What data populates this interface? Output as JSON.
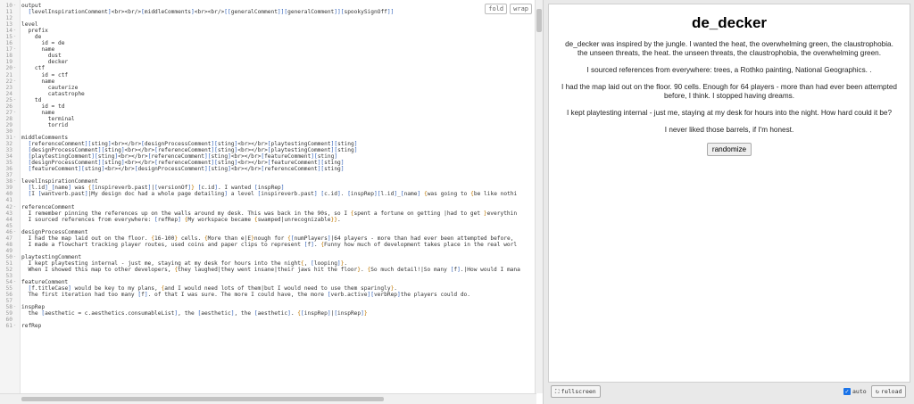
{
  "editor": {
    "fold_label": "fold",
    "wrap_label": "wrap",
    "lines": [
      {
        "n": "10",
        "f": "-",
        "t": "output"
      },
      {
        "n": "11",
        "f": "",
        "t": "  [levelInspirationComment]<br><br/>[middleComments]<br><br/>[[generalComment]][generalComment]][spookySignOff]]"
      },
      {
        "n": "12",
        "f": "",
        "t": ""
      },
      {
        "n": "13",
        "f": "",
        "t": "level"
      },
      {
        "n": "14",
        "f": "-",
        "t": "  prefix"
      },
      {
        "n": "15",
        "f": "-",
        "t": "    de"
      },
      {
        "n": "16",
        "f": "",
        "t": "      id = de"
      },
      {
        "n": "17",
        "f": "-",
        "t": "      name"
      },
      {
        "n": "18",
        "f": "",
        "t": "        dust"
      },
      {
        "n": "19",
        "f": "",
        "t": "        decker"
      },
      {
        "n": "20",
        "f": "-",
        "t": "    ctf"
      },
      {
        "n": "21",
        "f": "",
        "t": "      id = ctf"
      },
      {
        "n": "22",
        "f": "-",
        "t": "      name"
      },
      {
        "n": "23",
        "f": "",
        "t": "        cauterize"
      },
      {
        "n": "24",
        "f": "",
        "t": "        catastrophe"
      },
      {
        "n": "25",
        "f": "-",
        "t": "    td"
      },
      {
        "n": "26",
        "f": "",
        "t": "      id = td"
      },
      {
        "n": "27",
        "f": "-",
        "t": "      name"
      },
      {
        "n": "28",
        "f": "",
        "t": "        terminal"
      },
      {
        "n": "29",
        "f": "",
        "t": "        torrid"
      },
      {
        "n": "30",
        "f": "",
        "t": ""
      },
      {
        "n": "31",
        "f": "-",
        "t": "middleComments"
      },
      {
        "n": "32",
        "f": "",
        "t": "  [referenceComment][sting]<br></br>[designProcessComment][sting]<br></br>[playtestingComment][sting]"
      },
      {
        "n": "33",
        "f": "",
        "t": "  [designProcessComment][sting]<br></br>[referenceComment][sting]<br></br>[playtestingComment][sting]"
      },
      {
        "n": "34",
        "f": "",
        "t": "  [playtestingComment][sting]<br></br>[referenceComment][sting]<br></br>[featureComment][sting]"
      },
      {
        "n": "35",
        "f": "",
        "t": "  [designProcessComment][sting]<br></br>[referenceComment][sting]<br></br>[featureComment][sting]"
      },
      {
        "n": "36",
        "f": "",
        "t": "  [featureComment][sting]<br></br>[designProcessComment][sting]<br></br>[referenceComment][sting]"
      },
      {
        "n": "37",
        "f": "",
        "t": ""
      },
      {
        "n": "38",
        "f": "-",
        "t": "levelInspirationComment"
      },
      {
        "n": "39",
        "f": "",
        "t": "  [l.id]_[name] was {[inspireverb.past]|[versionOf]} [c.id]. I wanted [inspRep]"
      },
      {
        "n": "40",
        "f": "",
        "t": "  [I [wantverb.past]|My design doc had a whole page detailing] a level [inspireverb.past] [c.id]. [inspRep][l.id]_[name] {was going to {be like nothi"
      },
      {
        "n": "41",
        "f": "",
        "t": ""
      },
      {
        "n": "42",
        "f": "-",
        "t": "referenceComment"
      },
      {
        "n": "43",
        "f": "",
        "t": "  I remember pinning the references up on the walls around my desk. This was back in the 90s, so I {spent a fortune on getting |had to get }everythin"
      },
      {
        "n": "44",
        "f": "",
        "t": "  I sourced references from everywhere: [refRep] {My workspace became {swamped|unrecognizable}}."
      },
      {
        "n": "45",
        "f": "",
        "t": ""
      },
      {
        "n": "46",
        "f": "-",
        "t": "designProcessComment"
      },
      {
        "n": "47",
        "f": "",
        "t": "  I had the map laid out on the floor. {16-100} cells. {More than e|E}nough for {[numPlayers]|64 players - more than had ever been attempted before, "
      },
      {
        "n": "48",
        "f": "",
        "t": "  I made a flowchart tracking player routes, used coins and paper clips to represent [f]. {Funny how much of development takes place in the real worl"
      },
      {
        "n": "49",
        "f": "",
        "t": ""
      },
      {
        "n": "50",
        "f": "-",
        "t": "playtestingComment"
      },
      {
        "n": "51",
        "f": "",
        "t": "  I kept playtesting internal - just me, staying at my desk for hours into the night{, [looping]}."
      },
      {
        "n": "52",
        "f": "",
        "t": "  When I showed this map to other developers, {they laughed|they went insane|their jaws hit the floor}. {So much detail!|So many [f].|How would I mana"
      },
      {
        "n": "53",
        "f": "",
        "t": ""
      },
      {
        "n": "54",
        "f": "-",
        "t": "featureComment"
      },
      {
        "n": "55",
        "f": "",
        "t": "  [f.titleCase] would be key to my plans, {and I would need lots of them|but I would need to use them sparingly}."
      },
      {
        "n": "56",
        "f": "",
        "t": "  The first iteration had too many [f]. of that I was sure. The more I could have, the more [verb.active][verbRep]the players could do."
      },
      {
        "n": "57",
        "f": "",
        "t": ""
      },
      {
        "n": "58",
        "f": "-",
        "t": "inspRep"
      },
      {
        "n": "59",
        "f": "",
        "t": "  the [aesthetic = c.aesthetics.consumableList], the [aesthetic], the [aesthetic]. {[inspRep]|[inspRep]}"
      },
      {
        "n": "60",
        "f": "",
        "t": ""
      },
      {
        "n": "61",
        "f": "-",
        "t": "refRep"
      }
    ]
  },
  "preview": {
    "title": "de_decker",
    "paragraphs": [
      "de_decker was inspired by the jungle. I wanted the heat, the overwhelming green, the claustrophobia. the unseen threats, the heat. the unseen threats, the claustrophobia, the overwhelming green.",
      "I sourced references from everywhere: trees, a Rothko painting, National Geographics. .",
      "I had the map laid out on the floor. 90 cells. Enough for 64 players - more than had ever been attempted before, I think. I stopped having dreams.",
      "I kept playtesting internal - just me, staying at my desk for hours into the night. How hard could it be?",
      "I never liked those barrels, if I'm honest."
    ],
    "randomize_label": "randomize"
  },
  "footer": {
    "fullscreen_label": "fullscreen",
    "auto_label": "auto",
    "reload_label": "reload"
  },
  "colors": {
    "code_bracket": "#2e5fb8",
    "code_brace": "#c07800",
    "auto_checkbox": "#1a73e8"
  }
}
